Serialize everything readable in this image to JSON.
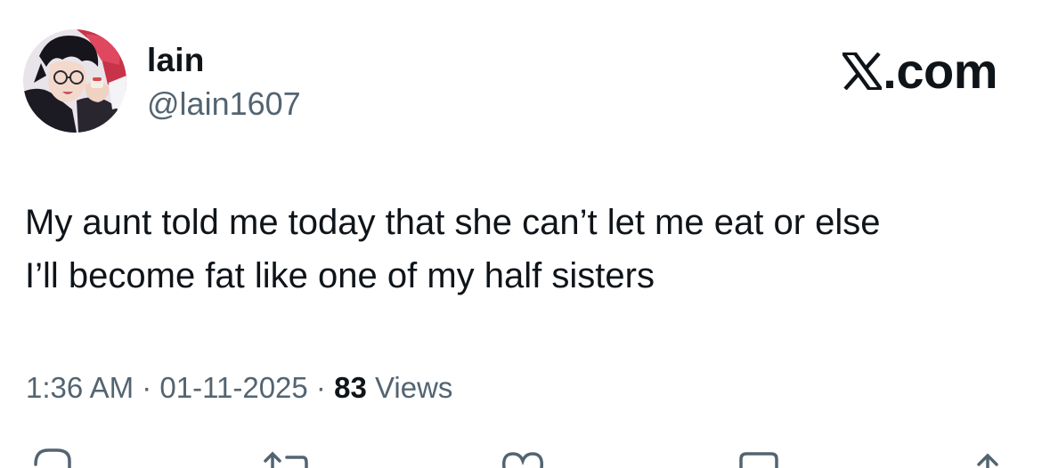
{
  "author": {
    "display_name": "lain",
    "handle": "@lain1607",
    "avatar_icon": "avatar-anime-boy-with-glasses"
  },
  "brand": {
    "icon": "x-logo-icon",
    "text": ".com"
  },
  "tweet": {
    "text": "My aunt told me today that she can’t let me eat or else\nI’ll become fat like one of my half sisters"
  },
  "meta": {
    "time": "1:36 AM",
    "separator": " · ",
    "date": "01-11-2025",
    "views_count": "83",
    "views_label": " Views"
  },
  "actions": [
    {
      "name": "reply",
      "icon": "reply-icon"
    },
    {
      "name": "retweet",
      "icon": "retweet-icon"
    },
    {
      "name": "like",
      "icon": "heart-icon"
    },
    {
      "name": "bookmark",
      "icon": "bookmark-icon"
    },
    {
      "name": "share",
      "icon": "share-icon"
    }
  ],
  "colors": {
    "text_primary": "#0f1419",
    "text_secondary": "#536471",
    "background": "#ffffff"
  }
}
